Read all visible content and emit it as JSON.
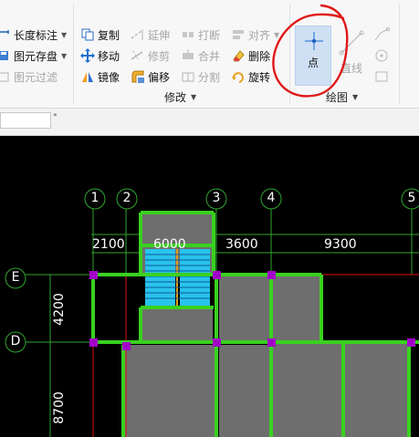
{
  "toolbar": {
    "col1": {
      "dim_label": "长度标注",
      "save_label": "图元存盘",
      "filter_label": "图元过滤"
    },
    "modify": {
      "copy": "复制",
      "extend": "延伸",
      "break": "打断",
      "align": "对齐",
      "move": "移动",
      "trim": "修剪",
      "merge": "合并",
      "delete": "删除",
      "mirror": "镜像",
      "offset": "偏移",
      "split": "分割",
      "rotate": "旋转",
      "group_label": "修改"
    },
    "draw": {
      "point": "点",
      "line": "直线",
      "group_label": "绘图"
    }
  },
  "canvas": {
    "axes_top": [
      "1",
      "2",
      "3",
      "4",
      "5"
    ],
    "axes_left": [
      "E",
      "D"
    ],
    "dims_top": [
      "2100",
      "6000",
      "3600",
      "9300"
    ],
    "dims_left": [
      "4200",
      "8700"
    ]
  },
  "colors": {
    "wall_green": "#39d11f",
    "column_purple": "#a200c8",
    "axis_red": "#e01010",
    "slab_gray": "#6e6e6e",
    "stair_cyan": "#29c3ec",
    "annotation_red": "#e01818",
    "selected_blue": "#cfe0f4"
  }
}
